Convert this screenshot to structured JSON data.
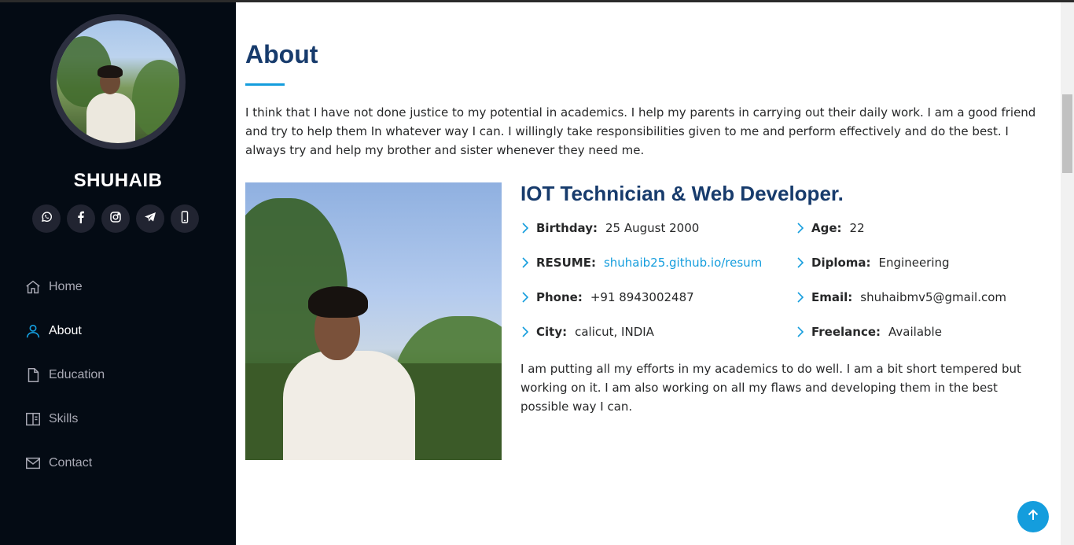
{
  "profile": {
    "name": "SHUHAIB"
  },
  "socials": [
    {
      "icon": "whatsapp-icon"
    },
    {
      "icon": "facebook-icon"
    },
    {
      "icon": "instagram-icon"
    },
    {
      "icon": "telegram-icon"
    },
    {
      "icon": "phone-icon"
    }
  ],
  "nav": {
    "items": [
      {
        "label": "Home",
        "icon": "home-icon"
      },
      {
        "label": "About",
        "icon": "person-icon",
        "active": true
      },
      {
        "label": "Education",
        "icon": "file-icon"
      },
      {
        "label": "Skills",
        "icon": "book-icon"
      },
      {
        "label": "Contact",
        "icon": "envelope-icon"
      }
    ]
  },
  "about": {
    "title": "About",
    "intro": "I think that I have not done justice to my potential in academics. I help my parents in carrying out their daily work. I am a good friend and try to help them In whatever way I can. I willingly take responsibilities given to me and perform effectively and do the best. I always try and help my brother and sister whenever they need me.",
    "role": "IOT Technician & Web Developer.",
    "details": {
      "birthday": {
        "label": "Birthday:",
        "value": "25 August 2000"
      },
      "age": {
        "label": "Age:",
        "value": "22"
      },
      "resume": {
        "label": "RESUME:",
        "value": "shuhaib25.github.io/resum"
      },
      "diploma": {
        "label": "Diploma:",
        "value": "Engineering"
      },
      "phone": {
        "label": "Phone:",
        "value": "+91 8943002487"
      },
      "email": {
        "label": "Email:",
        "value": "shuhaibmv5@gmail.com"
      },
      "city": {
        "label": "City:",
        "value": "calicut, INDIA"
      },
      "freelance": {
        "label": "Freelance:",
        "value": "Available"
      }
    },
    "outro": "I am putting all my efforts in my academics to do well. I am a bit short tempered but working on it. I am also working on all my flaws and developing them in the best possible way I can."
  },
  "colors": {
    "accent": "#149ddd",
    "heading": "#173b6c",
    "sidebar_bg": "#040b14"
  },
  "back_to_top": {
    "icon": "arrow-up-icon"
  }
}
